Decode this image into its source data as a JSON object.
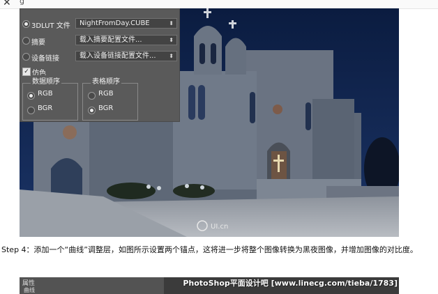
{
  "browser": {
    "close_glyph": "✕",
    "title_fragment": "g"
  },
  "panel": {
    "rows": [
      {
        "label": "3DLUT 文件",
        "value": "NightFromDay.CUBE",
        "selected": true
      },
      {
        "label": "摘要",
        "value": "载入摘要配置文件...",
        "selected": false
      },
      {
        "label": "设备链接",
        "value": "载入设备链接配置文件...",
        "selected": false
      }
    ],
    "dither_label": "仿色",
    "dither_checked": true,
    "data_order": {
      "title": "数据顺序",
      "options": [
        "RGB",
        "BGR"
      ],
      "selected": "RGB"
    },
    "table_order": {
      "title": "表格顺序",
      "options": [
        "RGB",
        "BGR"
      ],
      "selected": "BGR"
    }
  },
  "photo": {
    "logo_text": "UI.cn",
    "sky_color": "#0e2148"
  },
  "step": {
    "text": "Step 4：添加一个“曲线”调整层，如图所示设置两个锚点，这将进一步将整个图像转换为黑夜图像，并增加图像的对比度。"
  },
  "strip": {
    "panel_title": "属性",
    "panel_sub": "曲线",
    "watermark": "PhotoShop平面设计吧 [www.linecg.com/tieba/1783]"
  }
}
